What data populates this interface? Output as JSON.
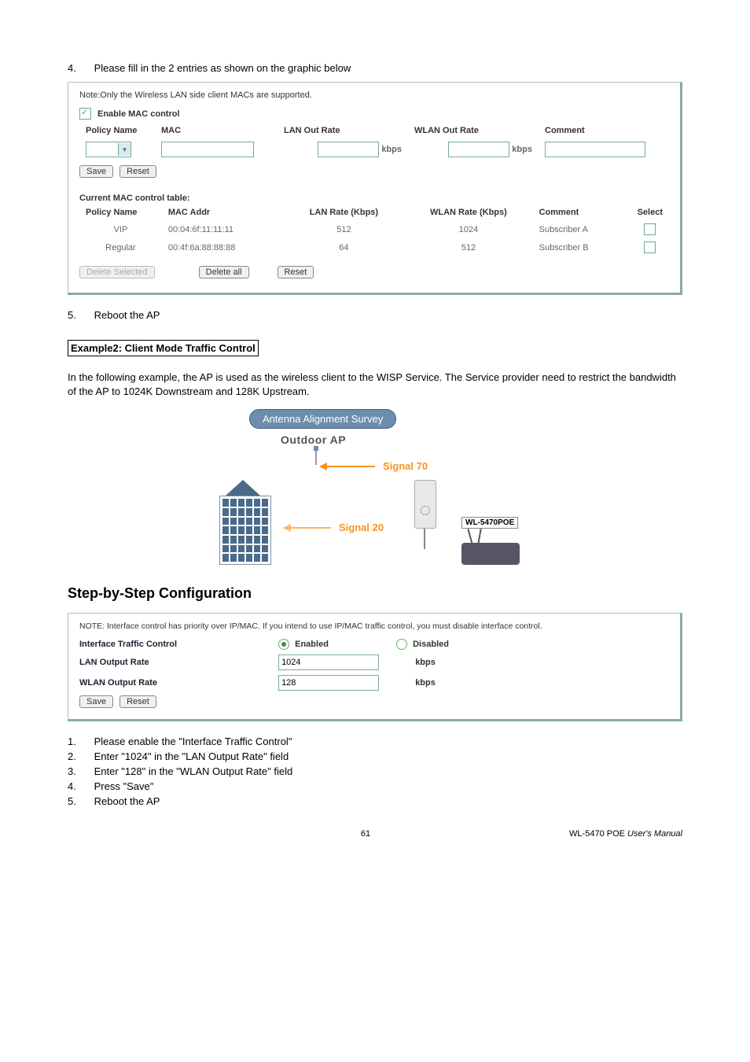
{
  "step4": {
    "num": "4.",
    "text": "Please fill in the 2 entries as shown on the graphic below"
  },
  "panel1": {
    "note": "Note:Only the Wireless LAN side client MACs are supported.",
    "enable_label": "Enable MAC control",
    "headers": {
      "policy": "Policy Name",
      "mac": "MAC",
      "lan": "LAN Out Rate",
      "wlan": "WLAN Out Rate",
      "comment": "Comment",
      "kbps": "kbps"
    },
    "buttons": {
      "save": "Save",
      "reset": "Reset"
    },
    "table_title": "Current MAC control table:",
    "table_headers": {
      "policy": "Policy Name",
      "mac": "MAC Addr",
      "lan": "LAN Rate (Kbps)",
      "wlan": "WLAN Rate (Kbps)",
      "comment": "Comment",
      "select": "Select"
    },
    "rows": [
      {
        "policy": "VIP",
        "mac": "00:04:6f:11:11:11",
        "lan": "512",
        "wlan": "1024",
        "comment": "Subscriber A"
      },
      {
        "policy": "Regular",
        "mac": "00:4f:6a:88:88:88",
        "lan": "64",
        "wlan": "512",
        "comment": "Subscriber B"
      }
    ],
    "footer_buttons": {
      "del_sel": "Delete Selected",
      "del_all": "Delete all",
      "reset": "Reset"
    }
  },
  "step5": {
    "num": "5.",
    "text": "Reboot the AP"
  },
  "example2_heading": "Example2: Client Mode Traffic Control",
  "example2_body": "In the following example, the AP is used as the wireless client to the WISP Service.    The Service provider need to restrict the bandwidth of the AP to 1024K Downstream and 128K Upstream.",
  "diagram": {
    "pill": "Antenna Alignment Survey",
    "outdoor": "Outdoor AP",
    "sig70": "Signal 70",
    "sig20": "Signal 20",
    "router_label": "WL-5470POE"
  },
  "section_heading": "Step-by-Step Configuration",
  "panel2": {
    "note": "NOTE: Interface control has priority over IP/MAC. If you intend to use IP/MAC traffic control, you must disable interface control.",
    "itc_label": "Interface Traffic Control",
    "enabled": "Enabled",
    "disabled": "Disabled",
    "lan_label": "LAN Output Rate",
    "wlan_label": "WLAN Output Rate",
    "lan_val": "1024",
    "wlan_val": "128",
    "kbps": "kbps",
    "save": "Save",
    "reset": "Reset"
  },
  "steps_bottom": [
    {
      "num": "1.",
      "text": "Please enable the \"Interface Traffic Control\""
    },
    {
      "num": "2.",
      "text": "Enter \"1024\" in the \"LAN Output Rate\" field"
    },
    {
      "num": "3.",
      "text": "Enter \"128\" in the \"WLAN Output Rate\" field"
    },
    {
      "num": "4.",
      "text": "Press \"Save\""
    },
    {
      "num": "5.",
      "text": "Reboot the AP"
    }
  ],
  "footer": {
    "page": "61",
    "right1": "WL-5470 POE ",
    "right2": "User's Manual"
  }
}
